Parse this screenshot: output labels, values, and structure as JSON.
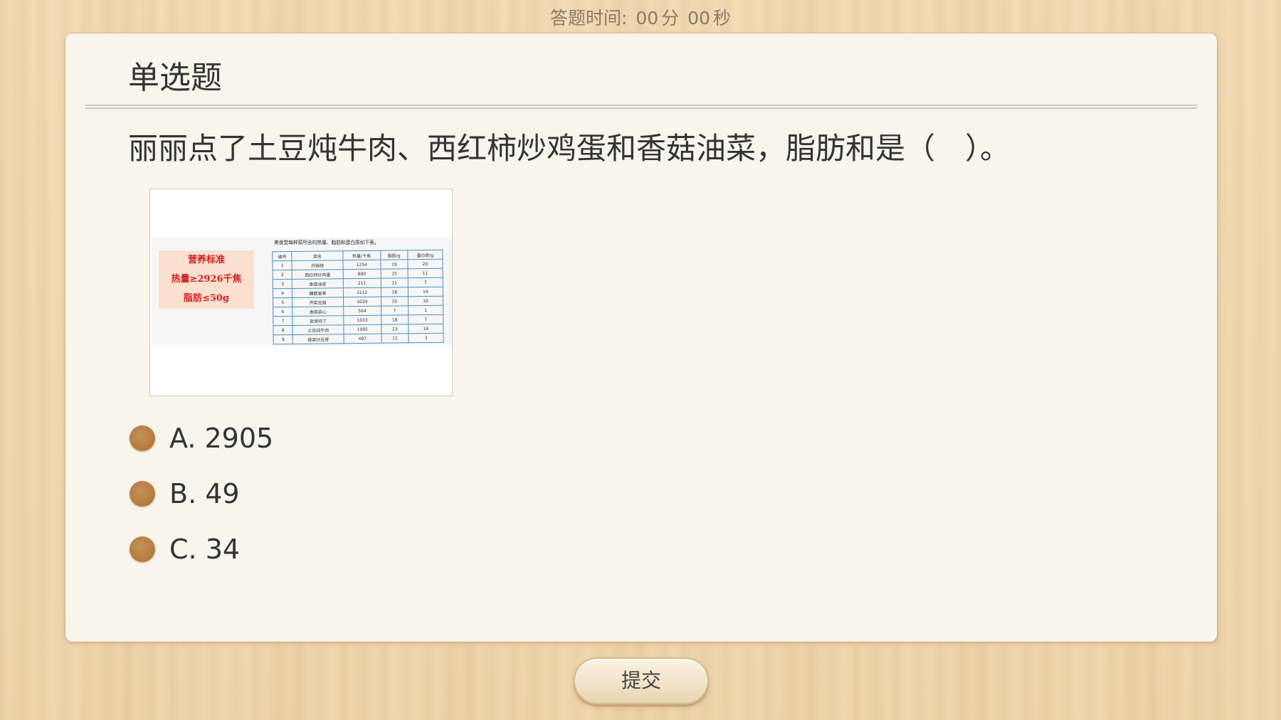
{
  "timer": {
    "label": "答题时间:",
    "minutes": "00",
    "minutes_unit": "分",
    "seconds": "00",
    "seconds_unit": "秒"
  },
  "card": {
    "title": "单选题",
    "question": "丽丽点了土豆炖牛肉、西红柿炒鸡蛋和香菇油菜，脂肪和是（　）。",
    "image": {
      "nutrition_lines": [
        "营养标准",
        "热量≥2926千焦",
        "脂肪≤50g"
      ],
      "table_caption": "美食堂每种菜所含的热量、脂肪和蛋白质如下表。",
      "table_headers": [
        "编号",
        "菜名",
        "热量/千焦",
        "脂肪/g",
        "蛋白质/g"
      ],
      "table_rows": [
        [
          "1",
          "丹锅排",
          "1254",
          "19",
          "20"
        ],
        [
          "2",
          "西红柿炒鸡蛋",
          "890",
          "15",
          "11"
        ],
        [
          "3",
          "香菇油菜",
          "211",
          "11",
          "7"
        ],
        [
          "4",
          "糖醋里脊",
          "2112",
          "18",
          "14"
        ],
        [
          "5",
          "芹菜豆腐",
          "1029",
          "16",
          "10"
        ],
        [
          "6",
          "香菇菜心",
          "564",
          "7",
          "1"
        ],
        [
          "7",
          "宫保鸡丁",
          "1033",
          "18",
          "7"
        ],
        [
          "8",
          "土豆炖牛肉",
          "1095",
          "23",
          "16"
        ],
        [
          "9",
          "拔菜炒豆芽",
          "497",
          "12",
          "3"
        ]
      ]
    },
    "options": [
      {
        "label": "A. 2905"
      },
      {
        "label": "B. 49"
      },
      {
        "label": "C. 34"
      }
    ]
  },
  "submit_label": "提交"
}
